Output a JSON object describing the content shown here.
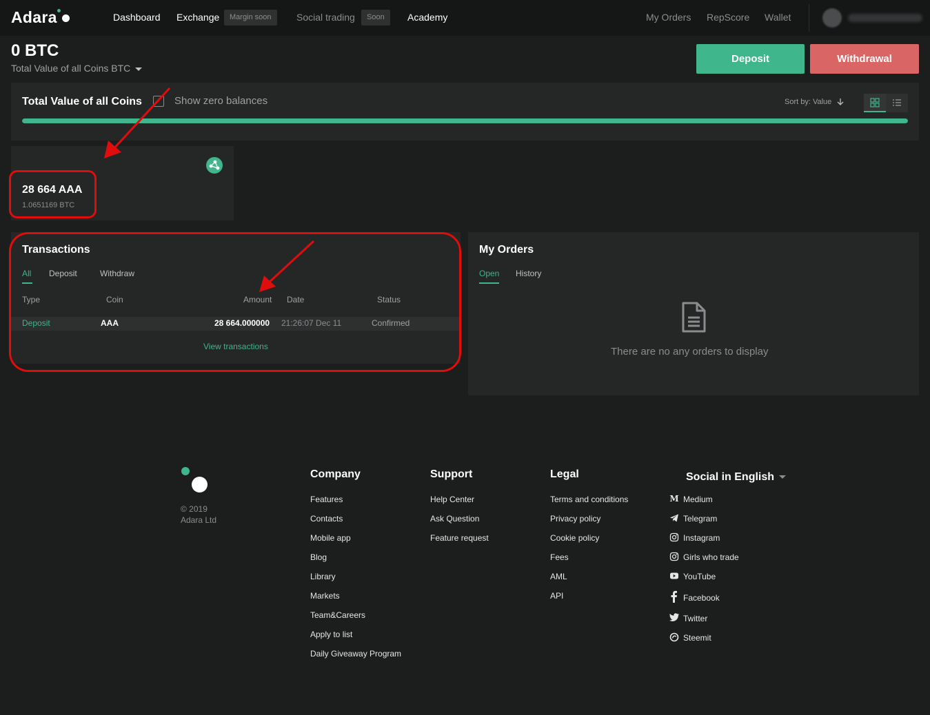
{
  "header": {
    "logo": "Adara",
    "nav": [
      {
        "label": "Dashboard"
      },
      {
        "label": "Exchange"
      },
      {
        "label": "Social trading"
      },
      {
        "label": "Academy"
      },
      {
        "label": "My Orders"
      },
      {
        "label": "RepScore"
      },
      {
        "label": "Wallet"
      }
    ],
    "badges": {
      "margin": "Margin soon",
      "soon": "Soon"
    }
  },
  "balance": {
    "value": "0 BTC",
    "subtitle": "Total Value of all Coins BTC"
  },
  "actions": {
    "deposit": "Deposit",
    "withdrawal": "Withdrawal"
  },
  "total_panel": {
    "title": "Total Value of all Coins",
    "show_zero": "Show zero balances",
    "sort_by": "Sort by: Value",
    "progress_fraction": 1.0
  },
  "coin_card": {
    "amount": "28 664 AAA",
    "btc_value": "1.0651169 BTC"
  },
  "transactions": {
    "title": "Transactions",
    "tabs": [
      "All",
      "Deposit",
      "Withdraw"
    ],
    "columns": [
      "Type",
      "Coin",
      "Amount",
      "Date",
      "Status"
    ],
    "rows": [
      {
        "type": "Deposit",
        "coin": "AAA",
        "amount": "28 664.000000",
        "date": "21:26:07 Dec 11",
        "status": "Confirmed"
      }
    ],
    "view_all": "View transactions"
  },
  "orders": {
    "title": "My Orders",
    "tabs": [
      "Open",
      "History"
    ],
    "empty": "There are no any orders to display"
  },
  "footer": {
    "copyright_year": "© 2019",
    "copyright_company": "Adara Ltd",
    "company": {
      "title": "Company",
      "links": [
        "Features",
        "Contacts",
        "Mobile app",
        "Blog",
        "Library",
        "Markets",
        "Team&Careers",
        "Apply to list",
        "Daily Giveaway Program"
      ]
    },
    "support": {
      "title": "Support",
      "links": [
        "Help Center",
        "Ask Question",
        "Feature request"
      ]
    },
    "legal": {
      "title": "Legal",
      "links": [
        "Terms and conditions",
        "Privacy policy",
        "Cookie policy",
        "Fees",
        "AML",
        "API"
      ]
    },
    "social": {
      "title": "Social in English",
      "links": [
        {
          "label": "Medium",
          "icon": "medium-icon"
        },
        {
          "label": "Telegram",
          "icon": "telegram-icon"
        },
        {
          "label": "Instagram",
          "icon": "instagram-icon"
        },
        {
          "label": "Girls who trade",
          "icon": "instagram-icon"
        },
        {
          "label": "YouTube",
          "icon": "youtube-icon"
        },
        {
          "label": "Facebook",
          "icon": "facebook-icon"
        },
        {
          "label": "Twitter",
          "icon": "twitter-icon"
        },
        {
          "label": "Steemit",
          "icon": "steemit-icon"
        }
      ]
    }
  },
  "colors": {
    "accent": "#3fb68b",
    "danger": "#d96565",
    "annotation": "#e00d0d",
    "background": "#1c1d1d",
    "panel": "#252626"
  }
}
